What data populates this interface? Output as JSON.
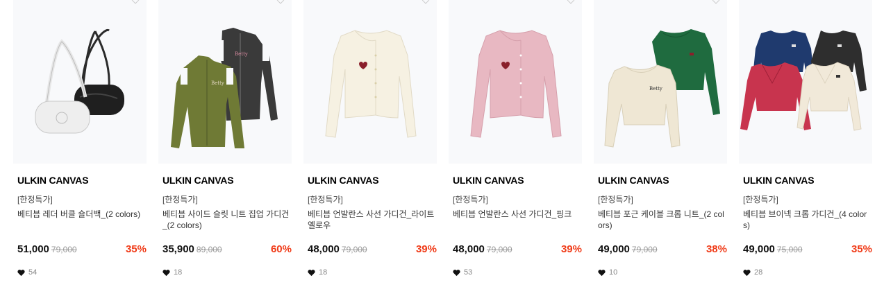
{
  "accent_color": "#f03a17",
  "products": [
    {
      "brand": "ULKIN CANVAS",
      "tag": "[한정특가]",
      "name": "베티븝 레더 버클 숄더백_(2 colors)",
      "price": "51,000",
      "original": "79,000",
      "discount": "35%",
      "likes": "54",
      "image_icon": "white-and-black-shoulder-bags"
    },
    {
      "brand": "ULKIN CANVAS",
      "tag": "[한정특가]",
      "name": "베티븝 사이드 슬릿 니트 집업 가디건_(2 colors)",
      "price": "35,900",
      "original": "89,000",
      "discount": "60%",
      "likes": "18",
      "image_icon": "khaki-and-charcoal-zip-cardigans"
    },
    {
      "brand": "ULKIN CANVAS",
      "tag": "[한정특가]",
      "name": "베티븝 언발란스 사선 가디건_라이트 옐로우",
      "price": "48,000",
      "original": "79,000",
      "discount": "39%",
      "likes": "18",
      "image_icon": "light-yellow-cardigan"
    },
    {
      "brand": "ULKIN CANVAS",
      "tag": "[한정특가]",
      "name": "베티븝 언발란스 사선 가디건_핑크",
      "price": "48,000",
      "original": "79,000",
      "discount": "39%",
      "likes": "53",
      "image_icon": "pink-cardigan"
    },
    {
      "brand": "ULKIN CANVAS",
      "tag": "[한정특가]",
      "name": "베티븝 포근 케이블 크롭 니트_(2 colors)",
      "price": "49,000",
      "original": "79,000",
      "discount": "38%",
      "likes": "10",
      "image_icon": "cream-and-green-cable-knits"
    },
    {
      "brand": "ULKIN CANVAS",
      "tag": "[한정특가]",
      "name": "베티븝 브이넥 크롭 가디건_(4 colors)",
      "price": "49,000",
      "original": "75,000",
      "discount": "35%",
      "likes": "28",
      "image_icon": "four-color-vneck-cardigans"
    }
  ]
}
